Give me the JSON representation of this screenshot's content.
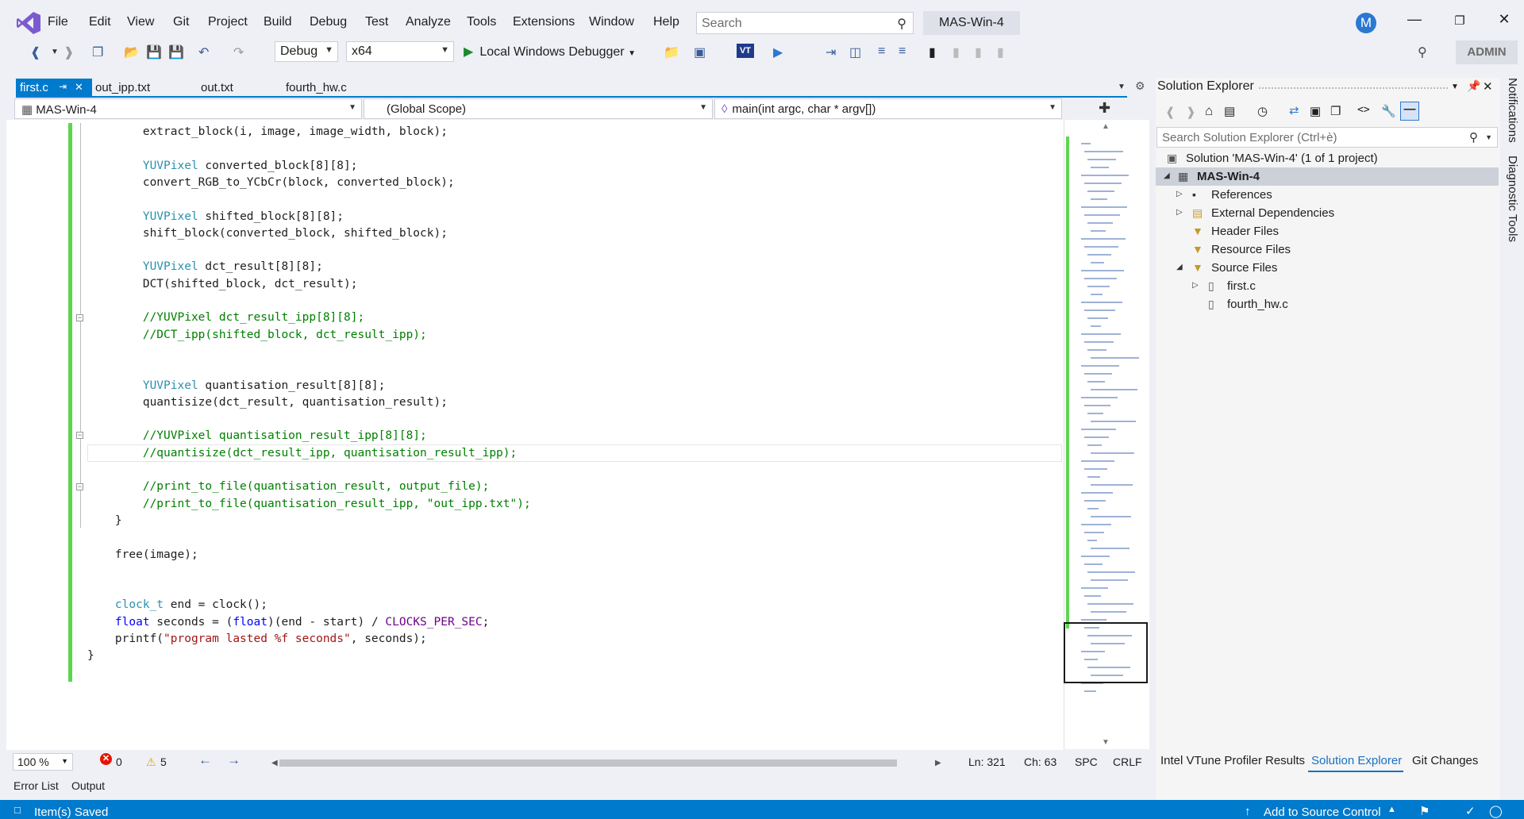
{
  "menubar": {
    "items": [
      "File",
      "Edit",
      "View",
      "Git",
      "Project",
      "Build",
      "Debug",
      "Test",
      "Analyze",
      "Tools",
      "Extensions",
      "Window",
      "Help"
    ],
    "search_placeholder": "Search",
    "project_title": "MAS-Win-4",
    "avatar_initial": "M"
  },
  "toolbar": {
    "config": "Debug",
    "platform": "x64",
    "debugger_label": "Local Windows Debugger",
    "admin_label": "ADMIN"
  },
  "tabs": [
    "first.c",
    "out_ipp.txt",
    "out.txt",
    "fourth_hw.c"
  ],
  "navbar": {
    "project": "MAS-Win-4",
    "scope": "(Global Scope)",
    "member": "main(int argc, char * argv[])"
  },
  "code_lines": [
    {
      "text": "        extract_block(i, image, image_width, block);",
      "kind": "plain"
    },
    {
      "text": "",
      "kind": "plain"
    },
    {
      "text": "        YUVPixel converted_block[8][8];",
      "kind": "plain"
    },
    {
      "text": "        convert_RGB_to_YCbCr(block, converted_block);",
      "kind": "plain"
    },
    {
      "text": "",
      "kind": "plain"
    },
    {
      "text": "        YUVPixel shifted_block[8][8];",
      "kind": "plain"
    },
    {
      "text": "        shift_block(converted_block, shifted_block);",
      "kind": "plain"
    },
    {
      "text": "",
      "kind": "plain"
    },
    {
      "text": "        YUVPixel dct_result[8][8];",
      "kind": "plain"
    },
    {
      "text": "        DCT(shifted_block, dct_result);",
      "kind": "plain"
    },
    {
      "text": "",
      "kind": "plain"
    },
    {
      "text": "        //YUVPixel dct_result_ipp[8][8];",
      "kind": "comment"
    },
    {
      "text": "        //DCT_ipp(shifted_block, dct_result_ipp);",
      "kind": "comment"
    },
    {
      "text": "",
      "kind": "plain"
    },
    {
      "text": "",
      "kind": "plain"
    },
    {
      "text": "        YUVPixel quantisation_result[8][8];",
      "kind": "plain"
    },
    {
      "text": "        quantisize(dct_result, quantisation_result);",
      "kind": "plain"
    },
    {
      "text": "",
      "kind": "plain"
    },
    {
      "text": "        //YUVPixel quantisation_result_ipp[8][8];",
      "kind": "comment"
    },
    {
      "text": "        //quantisize(dct_result_ipp, quantisation_result_ipp);",
      "kind": "comment"
    },
    {
      "text": "",
      "kind": "plain"
    },
    {
      "text": "        //print_to_file(quantisation_result, output_file);",
      "kind": "comment"
    },
    {
      "text": "        //print_to_file(quantisation_result_ipp, \"out_ipp.txt\");",
      "kind": "comment"
    },
    {
      "text": "    }",
      "kind": "plain"
    },
    {
      "text": "",
      "kind": "plain"
    },
    {
      "text": "    free(image);",
      "kind": "plain"
    },
    {
      "text": "",
      "kind": "plain"
    },
    {
      "text": "",
      "kind": "plain"
    },
    {
      "text": "    clock_t end = clock();",
      "kind": "plain"
    },
    {
      "text": "    float seconds = (float)(end - start) / CLOCKS_PER_SEC;",
      "kind": "plain"
    },
    {
      "text": "    printf(\"program lasted %f seconds\", seconds);",
      "kind": "plain"
    },
    {
      "text": "}",
      "kind": "plain"
    }
  ],
  "editor_status": {
    "zoom": "100 %",
    "errors": "0",
    "warnings": "5",
    "line": "Ln: 321",
    "col": "Ch: 63",
    "spc": "SPC",
    "crlf": "CRLF"
  },
  "bottom_tabs": [
    "Error List",
    "Output"
  ],
  "statusbar": {
    "message": "Item(s) Saved",
    "source_control": "Add to Source Control"
  },
  "solution_explorer": {
    "title": "Solution Explorer",
    "search_placeholder": "Search Solution Explorer (Ctrl+è)",
    "tree": [
      {
        "label": "Solution 'MAS-Win-4' (1 of 1 project)",
        "depth": 0,
        "twisty": "",
        "icon": "solution-icon"
      },
      {
        "label": "MAS-Win-4",
        "depth": 0,
        "twisty": "expanded",
        "icon": "project-icon",
        "selected": true,
        "bold": true
      },
      {
        "label": "References",
        "depth": 1,
        "twisty": "collapsed",
        "icon": "references-icon"
      },
      {
        "label": "External Dependencies",
        "depth": 1,
        "twisty": "collapsed",
        "icon": "external-dependencies-icon"
      },
      {
        "label": "Header Files",
        "depth": 1,
        "twisty": "",
        "icon": "filter-folder-icon"
      },
      {
        "label": "Resource Files",
        "depth": 1,
        "twisty": "",
        "icon": "filter-folder-icon"
      },
      {
        "label": "Source Files",
        "depth": 1,
        "twisty": "expanded",
        "icon": "filter-folder-icon"
      },
      {
        "label": "first.c",
        "depth": 2,
        "twisty": "collapsed",
        "icon": "c-file-icon"
      },
      {
        "label": "fourth_hw.c",
        "depth": 2,
        "twisty": "",
        "icon": "c-file-icon"
      }
    ],
    "bottom_tabs": [
      "Intel VTune Profiler Results",
      "Solution Explorer",
      "Git Changes"
    ]
  },
  "right_rail": [
    "Notifications",
    "Diagnostic Tools"
  ],
  "colors": {
    "accent": "#007acc",
    "change_bar": "#5dd650",
    "keyword": "#0000ff",
    "type": "#2b91af",
    "comment": "#008000",
    "string": "#a31515",
    "macro": "#6f008a"
  }
}
